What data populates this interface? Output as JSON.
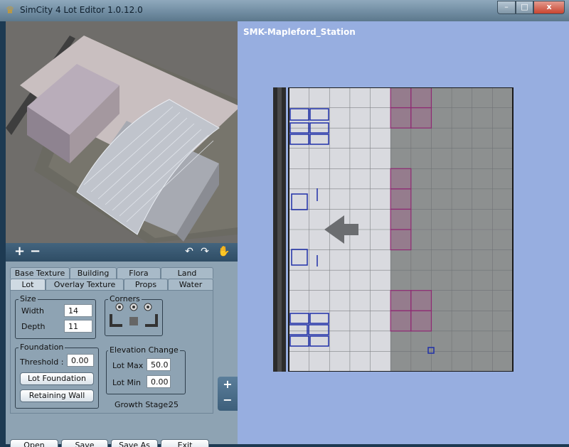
{
  "window": {
    "title": "SimCity 4 Lot Editor 1.0.12.0",
    "app_icon": "sc4-icon",
    "controls": {
      "minimize": "–",
      "maximize": "□",
      "close": "x"
    }
  },
  "preview": {
    "description_icon": "3d-preview"
  },
  "panel": {
    "zoom_in": "+",
    "zoom_out": "−",
    "rotate_left": "↶",
    "rotate_right": "↷",
    "hand": "✋",
    "tabs_row1": [
      "Base Texture",
      "Building",
      "Flora",
      "Land"
    ],
    "tabs_row2": [
      "Lot",
      "Overlay Texture",
      "Props",
      "Water"
    ],
    "active_tab": "Lot",
    "size": {
      "legend": "Size",
      "width_label": "Width",
      "width_value": "14",
      "depth_label": "Depth",
      "depth_value": "11"
    },
    "corners": {
      "legend": "Corners"
    },
    "foundation": {
      "legend": "Foundation",
      "threshold_label": "Threshold :",
      "threshold_value": "0.00",
      "lot_foundation_button": "Lot Foundation",
      "retaining_wall_button": "Retaining Wall"
    },
    "elevation": {
      "legend": "Elevation Change",
      "lot_max_label": "Lot Max",
      "lot_max_value": "50.0",
      "lot_min_label": "Lot Min",
      "lot_min_value": "0.00"
    },
    "growth_stage_label": "Growth Stage:",
    "growth_stage_value": "25",
    "buttons": {
      "open": "Open",
      "save": "Save",
      "save_as": "Save As",
      "exit": "Exit"
    },
    "side_zoom_in": "+",
    "side_zoom_out": "−"
  },
  "canvas": {
    "lot_name": "SMK-Mapleford_Station",
    "grid": {
      "cols": 11,
      "rows": 14
    },
    "colors": {
      "pavement": "#d9dadf",
      "asphalt": "#8d9090",
      "magenta": "#8e2a73",
      "blue": "#1f2fa8"
    }
  }
}
